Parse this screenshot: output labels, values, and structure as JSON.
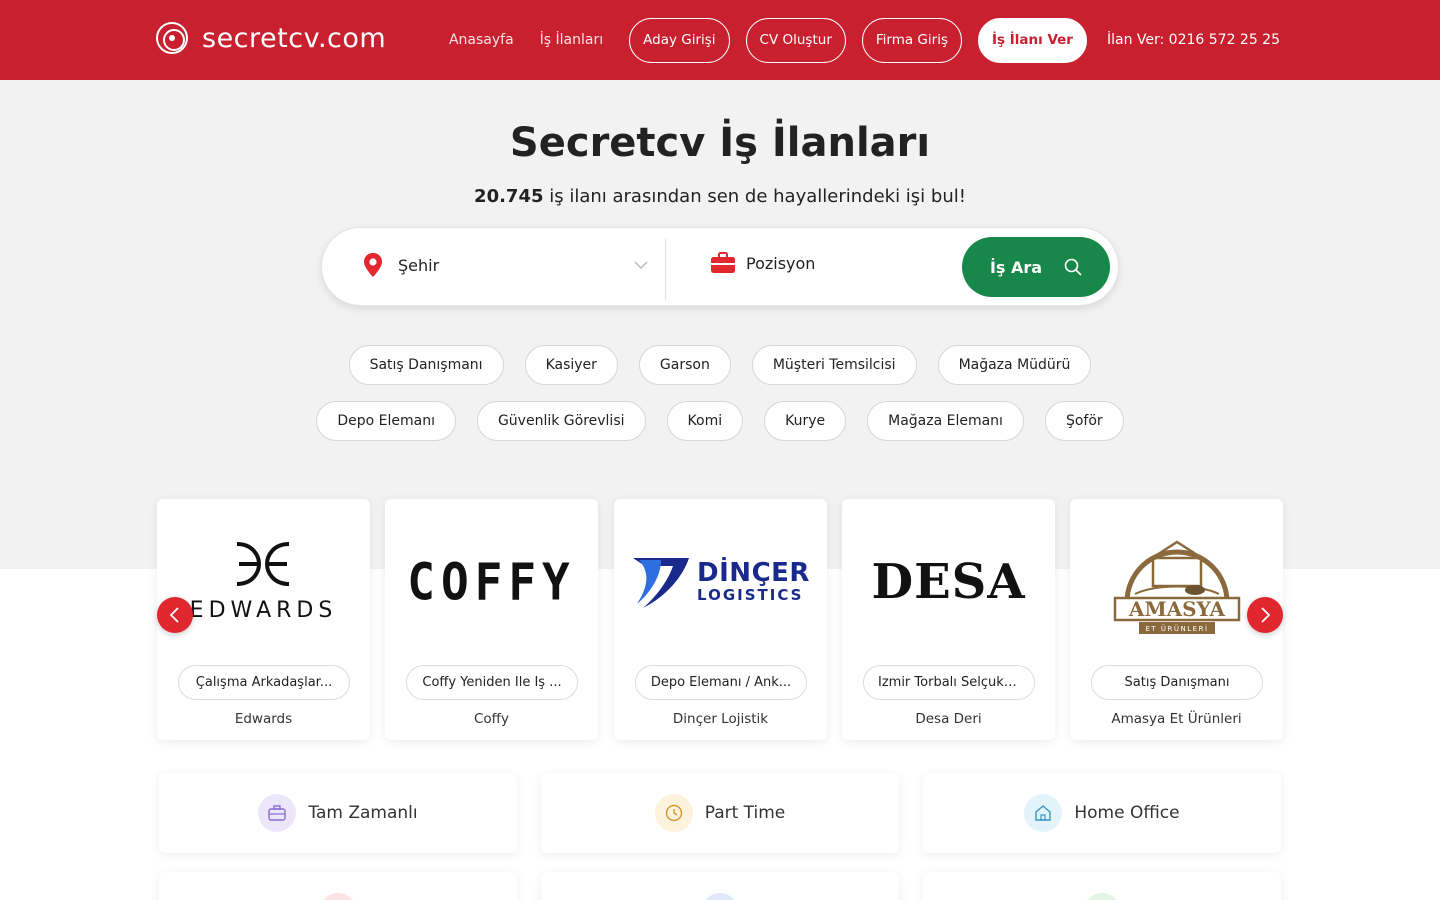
{
  "header": {
    "logo_text": "secretcv.com",
    "nav_links": [
      "Anasayfa",
      "İş İlanları"
    ],
    "nav_pills": [
      "Aday Girişi",
      "CV Oluştur",
      "Firma Giriş"
    ],
    "cta_label": "İş İlanı Ver",
    "phone": "İlan Ver: 0216 572 25 25"
  },
  "hero": {
    "title": "Secretcv İş İlanları",
    "count": "20.745",
    "subtitle_rest": " iş ilanı arasından sen de hayallerindeki işi bul!"
  },
  "search": {
    "city_placeholder": "Şehir",
    "position_placeholder": "Pozisyon",
    "button_label": "İş Ara"
  },
  "chips": {
    "row1": [
      "Satış Danışmanı",
      "Kasiyer",
      "Garson",
      "Müşteri Temsilcisi",
      "Mağaza Müdürü"
    ],
    "row2": [
      "Depo Elemanı",
      "Güvenlik Görevlisi",
      "Komi",
      "Kurye",
      "Mağaza Elemanı",
      "Şoför"
    ]
  },
  "companies": [
    {
      "logo_text": "EDWARDS",
      "job": "Çalışma Arkadaşlar...",
      "name": "Edwards"
    },
    {
      "logo_text": "COFFY",
      "job": "Coffy Yeniden İle İş ...",
      "name": "Coffy"
    },
    {
      "logo_text_1": "DİNÇER",
      "logo_text_2": "LOGISTICS",
      "job": "Depo Elemanı / Ank...",
      "name": "Dinçer Lojistik"
    },
    {
      "logo_text": "DESA",
      "job": "İzmir Torbalı Selçuk ...",
      "name": "Desa Deri"
    },
    {
      "logo_text": "AMASYA",
      "logo_sub": "ET ÜRÜNLERİ",
      "job": "Satış Danışmanı",
      "name": "Amasya Et Ürünleri"
    }
  ],
  "job_types": [
    {
      "label": "Tam Zamanlı",
      "icon": "briefcase-icon",
      "color": "#ece6fb"
    },
    {
      "label": "Part Time",
      "icon": "clock-icon",
      "color": "#fdf2dc"
    },
    {
      "label": "Home Office",
      "icon": "home-icon",
      "color": "#e3f3fa"
    }
  ],
  "colors": {
    "brand": "#c8202f",
    "search_button": "#17884a",
    "hero_bg": "#f2f2f2"
  }
}
